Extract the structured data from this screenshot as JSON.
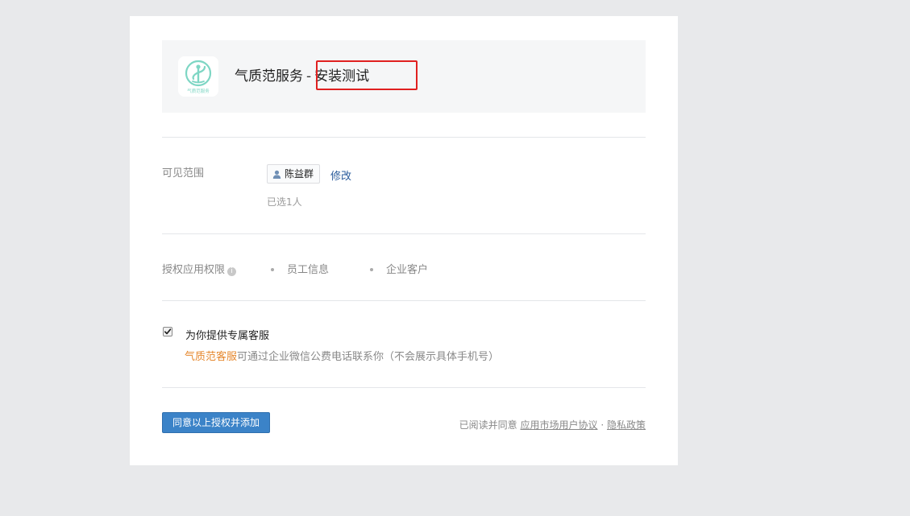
{
  "app": {
    "name": "气质范服务",
    "separator": "-",
    "suffix": "安装测试",
    "logo_text": "气质范服务",
    "logo_color": "#7ed6c4"
  },
  "visibility": {
    "label": "可见范围",
    "member_name": "陈益群",
    "edit_label": "修改",
    "selected_count": "已选1人"
  },
  "permissions": {
    "label": "授权应用权限",
    "info_icon": "i",
    "items": [
      "员工信息",
      "企业客户"
    ]
  },
  "service": {
    "checked": true,
    "title": "为你提供专属客服",
    "brand_name": "气质范客服",
    "description": "可通过企业微信公费电话联系你（不会展示具体手机号）"
  },
  "footer": {
    "submit_label": "同意以上授权并添加",
    "agreement_prefix": "已阅读并同意",
    "user_agreement_label": "应用市场用户协议",
    "dot": "·",
    "privacy_label": "隐私政策"
  },
  "colors": {
    "accent_blue": "#3b83c8",
    "link_blue": "#2b5c9c",
    "brand_orange": "#e5872d",
    "highlight_red": "#e02020"
  }
}
